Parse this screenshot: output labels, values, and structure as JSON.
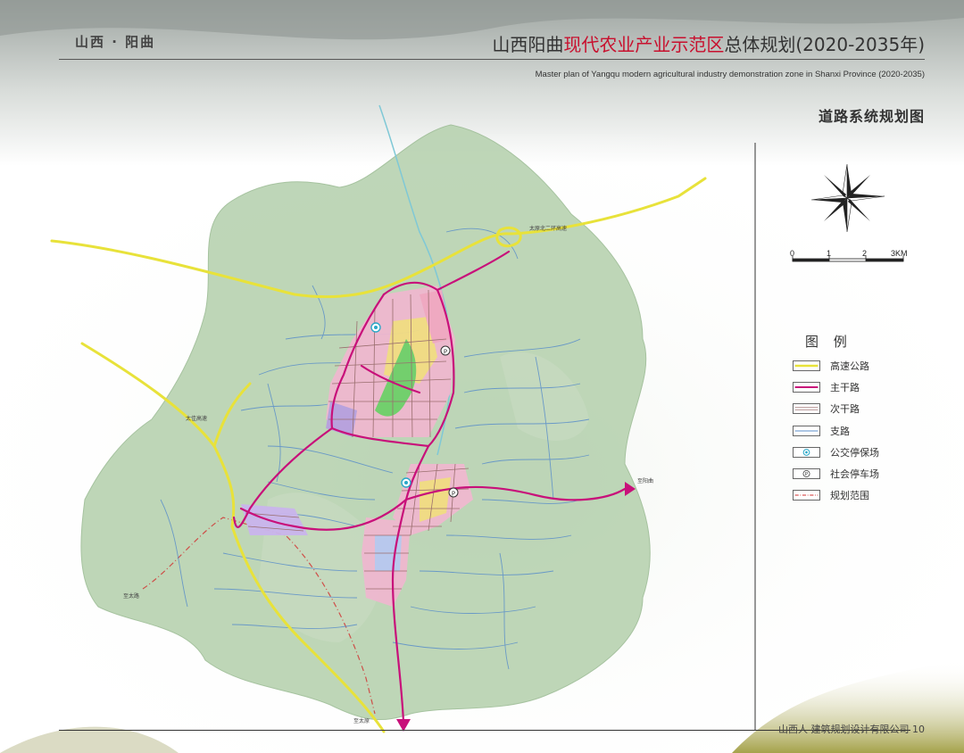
{
  "header": {
    "region_label": "山西 · 阳曲",
    "title_prefix": "山西阳曲",
    "title_highlight": "现代农业产业示范区",
    "title_suffix": "总体规划(2020-2035年)",
    "subtitle_en": "Master plan of Yangqu modern agricultural industry demonstration zone in Shanxi Province (2020-2035)",
    "map_title": "道路系统规划图"
  },
  "scale_bar": {
    "labels": [
      "0",
      "1",
      "2",
      "3KM"
    ]
  },
  "legend": {
    "title": "图 例",
    "items": [
      {
        "label": "高速公路",
        "type": "expressway",
        "color": "#e8e23a"
      },
      {
        "label": "主干路",
        "type": "arterial",
        "color": "#c8107a"
      },
      {
        "label": "次干路",
        "type": "secondary",
        "color": "#9a6e6e"
      },
      {
        "label": "支路",
        "type": "branch",
        "color": "#5b8fc9"
      },
      {
        "label": "公交停保场",
        "type": "bus-depot",
        "icon": "bus-depot-icon",
        "color": "#2aa8c8"
      },
      {
        "label": "社会停车场",
        "type": "parking",
        "icon": "parking-icon",
        "color": "#333333"
      },
      {
        "label": "规划范围",
        "type": "boundary",
        "color": "#d22c2c"
      }
    ]
  },
  "map_labels": {
    "road_ring": "太原北二环高速",
    "road_west": "太佳高速",
    "dest_east": "至阳曲",
    "dest_southwest": "至太路",
    "dest_south": "至太原"
  },
  "footer": {
    "company": "山西人   建筑规划设计有限公司",
    "page": "10"
  },
  "colors": {
    "accent_red": "#c8102e",
    "terrain": "#b9d3b2",
    "urban_core": "#efb8cf"
  }
}
